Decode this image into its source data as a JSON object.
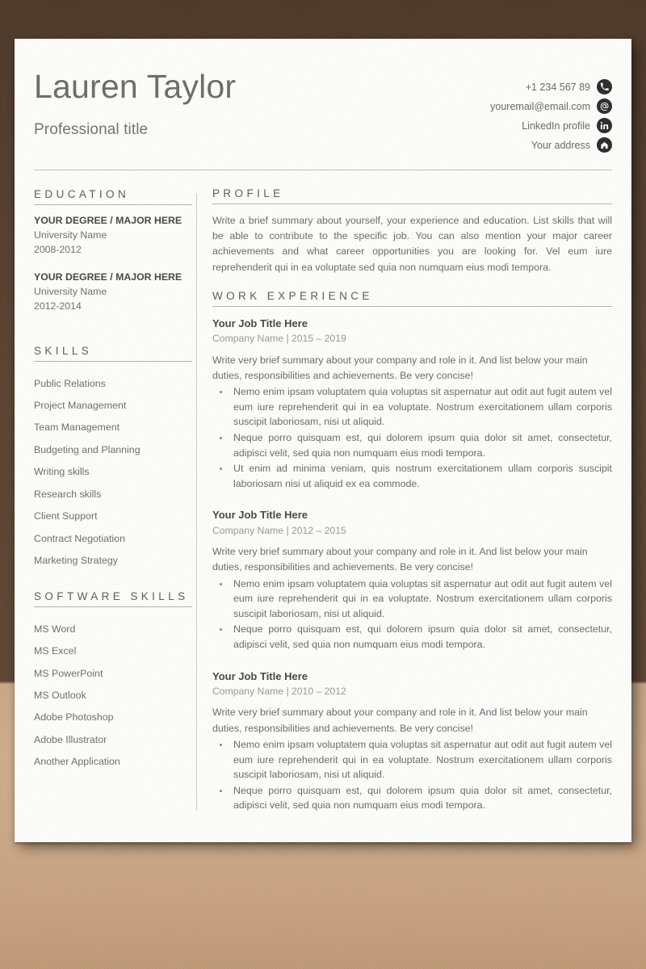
{
  "header": {
    "full_name": "Lauren Taylor",
    "professional_title": "Professional title",
    "contacts": [
      {
        "text": "+1 234 567 89",
        "icon": "phone-icon"
      },
      {
        "text": "youremail@email.com",
        "icon": "email-at-icon"
      },
      {
        "text": "LinkedIn profile",
        "icon": "linkedin-icon"
      },
      {
        "text": "Your address",
        "icon": "home-address-icon"
      }
    ]
  },
  "sidebar": {
    "education": {
      "heading": "EDUCATION",
      "items": [
        {
          "degree": "YOUR DEGREE / MAJOR HERE",
          "school": "University Name",
          "years": "2008-2012"
        },
        {
          "degree": "YOUR DEGREE / MAJOR HERE",
          "school": "University Name",
          "years": "2012-2014"
        }
      ]
    },
    "skills": {
      "heading": "SKILLS",
      "items": [
        "Public Relations",
        "Project Management",
        "Team Management",
        "Budgeting and Planning",
        "Writing skills",
        "Research skills",
        "Client Support",
        "Contract Negotiation",
        "Marketing Strategy"
      ]
    },
    "software_skills": {
      "heading": "SOFTWARE SKILLS",
      "items": [
        "MS Word",
        "MS Excel",
        "MS PowerPoint",
        "MS Outlook",
        "Adobe Photoshop",
        "Adobe Illustrator",
        "Another Application"
      ]
    }
  },
  "main": {
    "profile": {
      "heading": "PROFILE",
      "text": "Write a brief summary about yourself, your experience and education. List skills that will be able to contribute to the specific job. You can also mention your major career achievements and what career opportunities you are looking for. Vel eum iure reprehenderit qui in ea voluptate sed quia non numquam eius modi tempora."
    },
    "work_experience": {
      "heading": "WORK EXPERIENCE",
      "jobs": [
        {
          "title": "Your Job Title Here",
          "company": "Company Name | 2015 – 2019",
          "summary": "Write very brief summary about your company and role in it. And list below your main duties, responsibilities and achievements. Be very concise!",
          "bullets": [
            "Nemo enim ipsam voluptatem quia voluptas sit aspernatur aut odit aut fugit autem vel eum iure reprehenderit qui in ea voluptate. Nostrum exercitationem ullam corporis suscipit laboriosam, nisi ut aliquid.",
            "Neque porro quisquam est, qui dolorem ipsum quia dolor sit amet, consectetur, adipisci velit, sed quia non numquam eius modi tempora.",
            "Ut enim ad minima veniam, quis nostrum exercitationem ullam corporis suscipit laboriosam nisi ut aliquid ex ea commode."
          ]
        },
        {
          "title": "Your Job Title Here",
          "company": "Company Name | 2012 – 2015",
          "summary": "Write very brief summary about your company and role in it. And list below your main duties, responsibilities and achievements. Be very concise!",
          "bullets": [
            "Nemo enim ipsam voluptatem quia voluptas sit aspernatur aut odit aut fugit autem vel eum iure reprehenderit qui in ea voluptate. Nostrum exercitationem ullam corporis suscipit laboriosam, nisi ut aliquid.",
            "Neque porro quisquam est, qui dolorem ipsum quia dolor sit amet, consectetur, adipisci velit, sed quia non numquam eius modi tempora."
          ]
        },
        {
          "title": "Your Job Title Here",
          "company": "Company Name | 2010 – 2012",
          "summary": "Write very brief summary about your company and role in it. And list below your main duties, responsibilities and achievements. Be very concise!",
          "bullets": [
            "Nemo enim ipsam voluptatem quia voluptas sit aspernatur aut odit aut fugit autem vel eum iure reprehenderit qui in ea voluptate. Nostrum exercitationem ullam corporis suscipit laboriosam, nisi ut aliquid.",
            "Neque porro quisquam est, qui dolorem ipsum quia dolor sit amet, consectetur, adipisci velit, sed quia non numquam eius modi tempora."
          ]
        }
      ]
    }
  },
  "colors": {
    "backdrop_dark": "#5b4433",
    "backdrop_light": "#cbaa89",
    "paper": "#fdfdfc",
    "heading_text": "#5e5e5e",
    "body_text": "#6d6d6d",
    "muted_text": "#9a9a9a",
    "icon_badge": "#2f2f2f",
    "rule": "#b5b5b5"
  }
}
